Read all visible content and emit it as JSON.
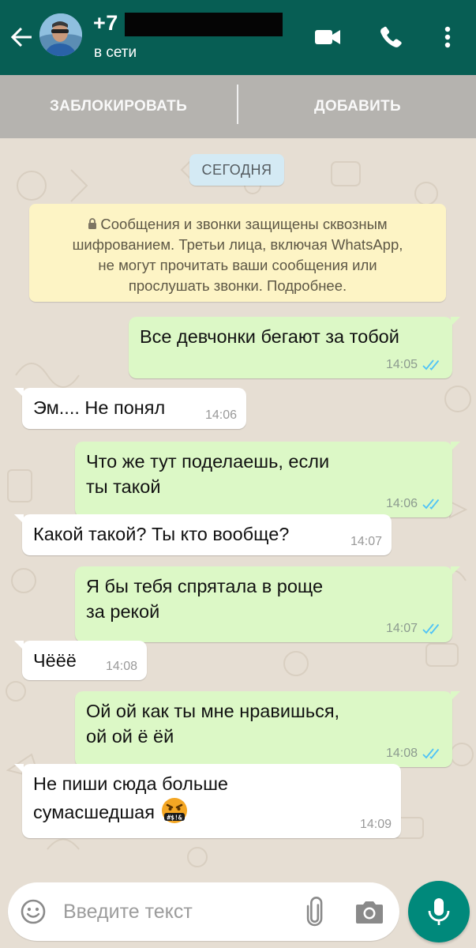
{
  "header": {
    "contact_name": "+7",
    "status": "в сети",
    "icons": [
      "back-arrow-icon",
      "video-call-icon",
      "phone-icon",
      "more-vert-icon"
    ],
    "color": "#075e54"
  },
  "actions": {
    "block_label": "ЗАБЛОКИРОВАТЬ",
    "add_label": "ДОБАВИТЬ"
  },
  "chat": {
    "date_chip": "СЕГОДНЯ",
    "encryption_notice": {
      "line1": "Сообщения и звонки защищены сквозным",
      "line2": "шифрованием. Третьи лица, включая WhatsApp,",
      "line3": "не могут прочитать ваши сообщения или",
      "line4": "прослушать звонки. Подробнее."
    },
    "messages": [
      {
        "direction": "out",
        "text": "Все девчонки бегают за тобой",
        "time": "14:05",
        "read": true
      },
      {
        "direction": "in",
        "text": "Эм.... Не понял",
        "time": "14:06"
      },
      {
        "direction": "out",
        "text": "Что же тут поделаешь, если\nты такой",
        "time": "14:06",
        "read": true
      },
      {
        "direction": "in",
        "text": "Какой такой? Ты кто вообще?",
        "time": "14:07"
      },
      {
        "direction": "out",
        "text": "Я бы тебя спрятала в роще\nза рекой",
        "time": "14:07",
        "read": true
      },
      {
        "direction": "in",
        "text": "Чёёё",
        "time": "14:08"
      },
      {
        "direction": "out",
        "text": "Ой ой как ты мне нравишься,\nой ой ё ёй",
        "time": "14:08",
        "read": true
      },
      {
        "direction": "in",
        "text": "Не пиши сюда больше\nсумасшедшая",
        "emoji": "face-with-symbols-on-mouth",
        "emoji_text": "#$!&",
        "time": "14:09"
      }
    ],
    "colors": {
      "outgoing": "#dcf8c6",
      "incoming": "#ffffff",
      "read_ticks": "#4fc3f7"
    }
  },
  "composer": {
    "placeholder": "Введите текст",
    "icons": [
      "emoji-icon",
      "attach-icon",
      "camera-icon",
      "mic-icon"
    ],
    "accent": "#00897b"
  }
}
